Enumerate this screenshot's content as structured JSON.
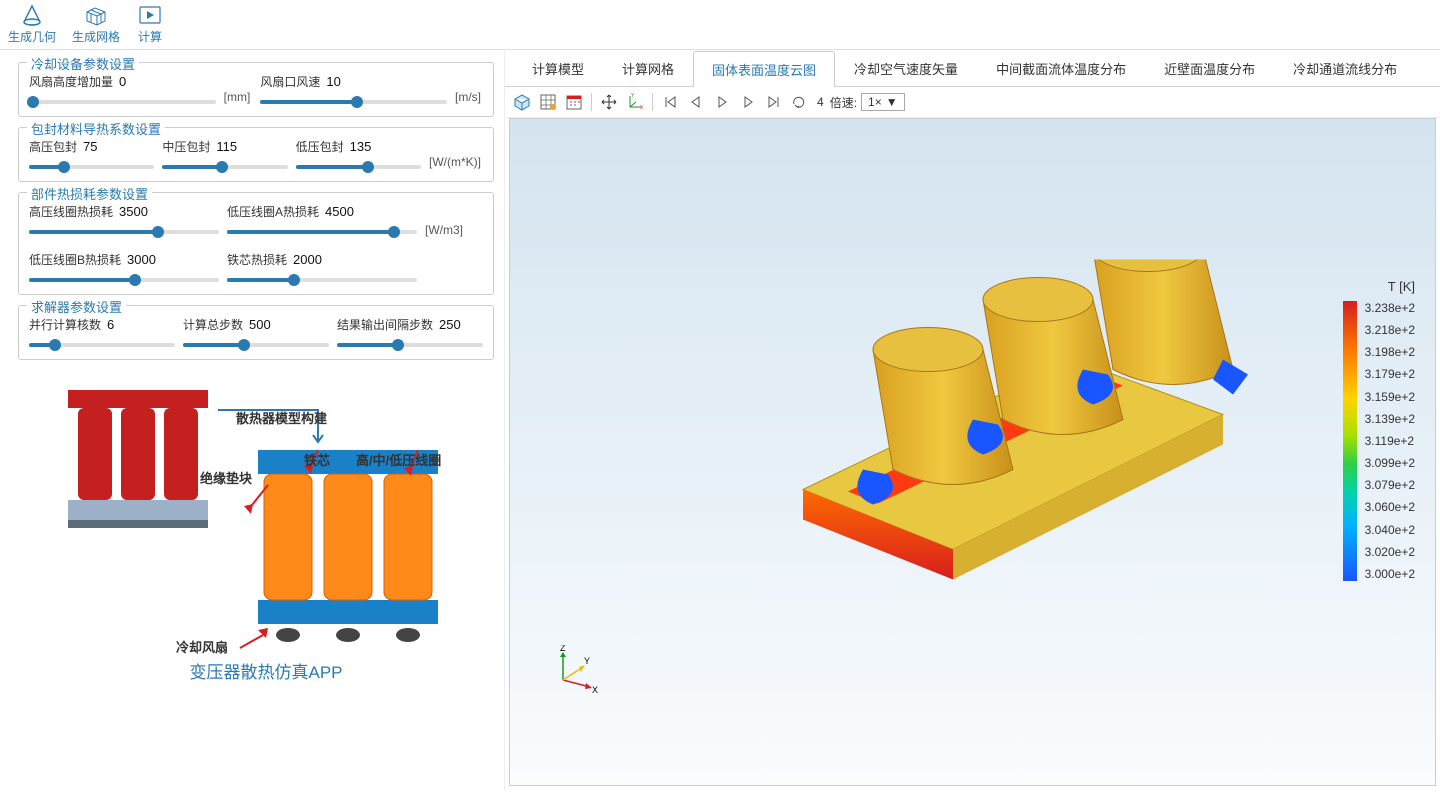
{
  "toolbar": {
    "gen_geometry": "生成几何",
    "gen_mesh": "生成网格",
    "compute": "计算"
  },
  "panels": {
    "cooling": {
      "title": "冷却设备参数设置",
      "fan_height_inc": {
        "label": "风扇高度增加量",
        "value": "0",
        "unit": "[mm]",
        "pct": 2
      },
      "fan_speed": {
        "label": "风扇口风速",
        "value": "10",
        "unit": "[m/s]",
        "pct": 52
      }
    },
    "thermal": {
      "title": "包封材料导热系数设置",
      "hv": {
        "label": "高压包封",
        "value": "75",
        "pct": 28
      },
      "mv": {
        "label": "中压包封",
        "value": "115",
        "pct": 48
      },
      "lv": {
        "label": "低压包封",
        "value": "135",
        "pct": 58
      },
      "unit": "[W/(m*K)]"
    },
    "heat": {
      "title": "部件热损耗参数设置",
      "hv_coil": {
        "label": "高压线圈热损耗",
        "value": "3500",
        "pct": 68
      },
      "lvA_coil": {
        "label": "低压线圈A热损耗",
        "value": "4500",
        "pct": 88
      },
      "lvB_coil": {
        "label": "低压线圈B热损耗",
        "value": "3000",
        "pct": 56
      },
      "core": {
        "label": "铁芯热损耗",
        "value": "2000",
        "pct": 35
      },
      "unit": "[W/m3]"
    },
    "solver": {
      "title": "求解器参数设置",
      "parallel": {
        "label": "并行计算核数",
        "value": "6",
        "pct": 18
      },
      "total_steps": {
        "label": "计算总步数",
        "value": "500",
        "pct": 42
      },
      "output_interval": {
        "label": "结果输出间隔步数",
        "value": "250",
        "pct": 42
      }
    }
  },
  "diagram": {
    "title": "变压器散热仿真APP",
    "model_build": "散热器模型构建",
    "insulation": "绝缘垫块",
    "core": "铁芯",
    "coils": "高/中/低压线圈",
    "fan": "冷却风扇"
  },
  "tabs": [
    "计算模型",
    "计算网格",
    "固体表面温度云图",
    "冷却空气速度矢量",
    "中间截面流体温度分布",
    "近壁面温度分布",
    "冷却通道流线分布"
  ],
  "active_tab": 2,
  "playback": {
    "frame": "4",
    "speed_label": "倍速:",
    "speed_value": "1×"
  },
  "legend": {
    "title": "T [K]",
    "ticks": [
      "3.238e+2",
      "3.218e+2",
      "3.198e+2",
      "3.179e+2",
      "3.159e+2",
      "3.139e+2",
      "3.119e+2",
      "3.099e+2",
      "3.079e+2",
      "3.060e+2",
      "3.040e+2",
      "3.020e+2",
      "3.000e+2"
    ]
  },
  "axis": {
    "x": "X",
    "y": "Y",
    "z": "Z"
  }
}
